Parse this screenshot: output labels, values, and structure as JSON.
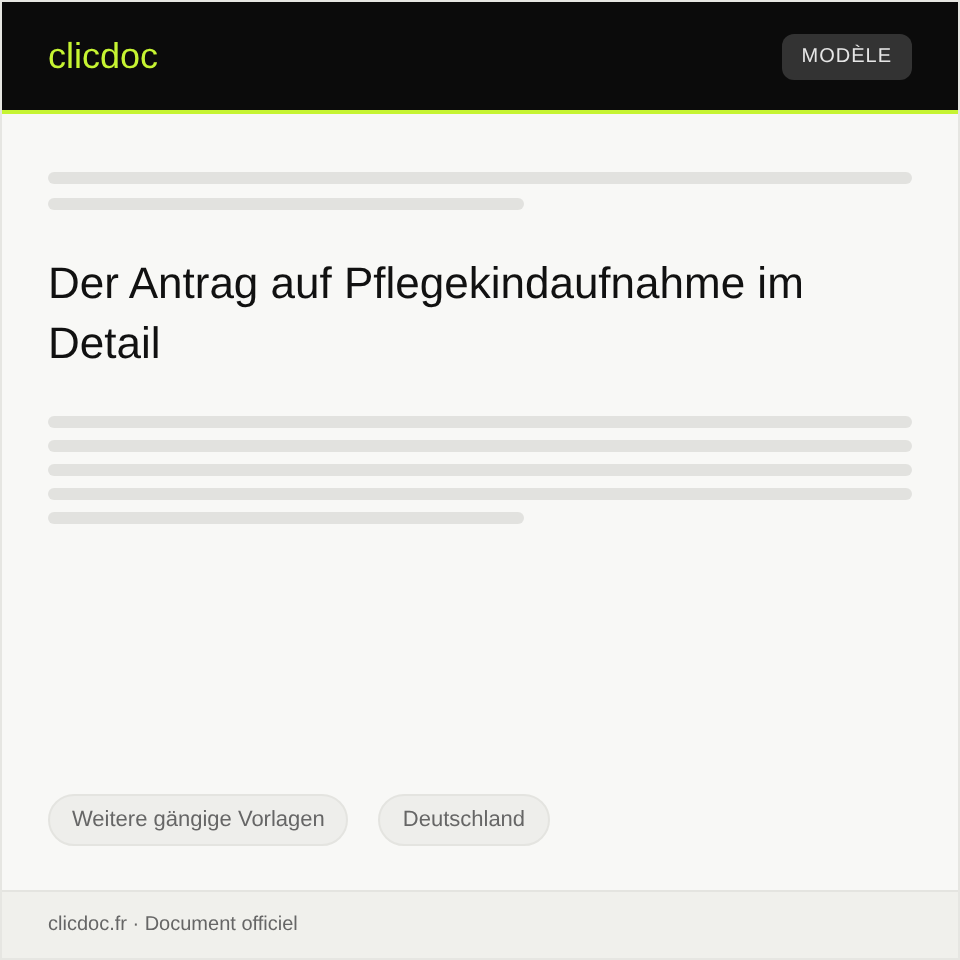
{
  "header": {
    "logo": "clicdoc",
    "badge": "MODÈLE"
  },
  "title": "Der Antrag auf Pflegekindaufnahme  im Detail",
  "tags": [
    "Weitere gängige Vorlagen",
    "Deutschland"
  ],
  "footer": "clicdoc.fr · Document officiel"
}
